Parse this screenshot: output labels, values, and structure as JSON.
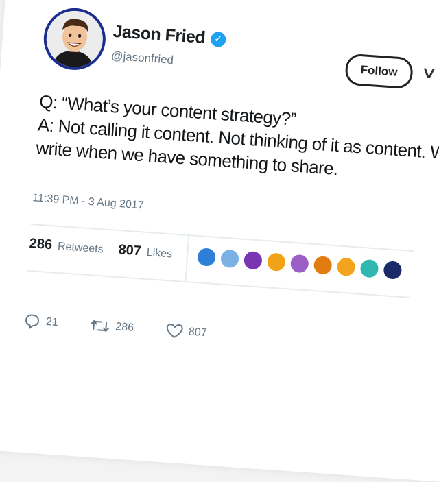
{
  "tweet": {
    "author_name": "Jason Fried",
    "handle": "@jasonfried",
    "follow_label": "Follow",
    "text_lines": [
      "Q: “What’s your content strategy?”",
      "A: Not calling it content. Not thinking of it as content. We",
      "write when we have something to share."
    ],
    "timestamp": "11:39 PM - 3 Aug 2017",
    "retweets_count": "286",
    "retweets_label": "Retweets",
    "likes_count": "807",
    "likes_label": "Likes",
    "liker_avatar_colors": [
      "#2f7fd8",
      "#7cb1e6",
      "#7a35b0",
      "#f0a318",
      "#9b5fc6",
      "#e07c10",
      "#f2a51c",
      "#30b8b0",
      "#1b2b6a"
    ],
    "actions": {
      "reply_count": "21",
      "retweet_count": "286",
      "like_count": "807"
    },
    "icons": [
      "verified-badge-icon",
      "chevron-down-icon",
      "reply-icon",
      "retweet-icon",
      "heart-icon"
    ]
  }
}
